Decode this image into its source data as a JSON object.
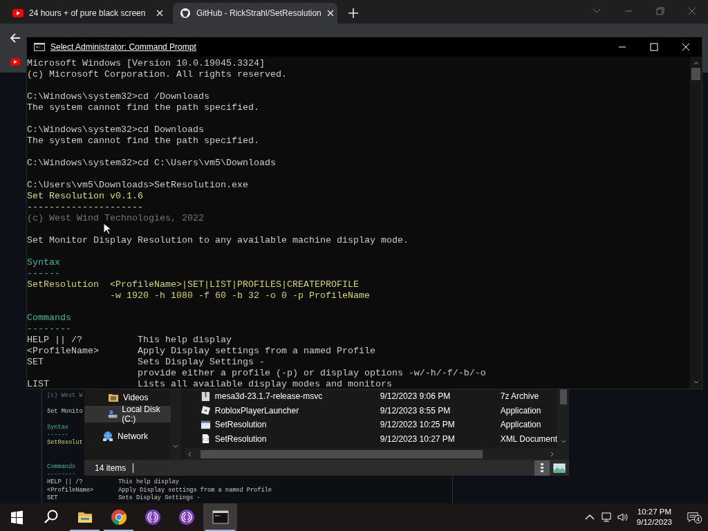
{
  "browser": {
    "tabs": [
      {
        "title": "24 hours + of pure black screen",
        "kind": "video",
        "selected": false
      },
      {
        "title": "GitHub - RickStrahl/SetResolution",
        "kind": "cat",
        "selected": true
      }
    ]
  },
  "console": {
    "title": "Select Administrator: Command Prompt",
    "lines": [
      {
        "text": "Microsoft Windows [Version 10.0.19045.3324]",
        "kind": "normal"
      },
      {
        "text": "(c) Microsoft Corporation. All rights reserved.",
        "kind": "normal"
      },
      {
        "kind": "blank"
      },
      {
        "text": "C:\\Windows\\system32>cd /Downloads",
        "kind": "normal"
      },
      {
        "text": "The system cannot find the path specified.",
        "kind": "normal"
      },
      {
        "kind": "blank"
      },
      {
        "text": "C:\\Windows\\system32>cd Downloads",
        "kind": "normal"
      },
      {
        "text": "The system cannot find the path specified.",
        "kind": "normal"
      },
      {
        "kind": "blank"
      },
      {
        "text": "C:\\Windows\\system32>cd C:\\Users\\vm5\\Downloads",
        "kind": "normal"
      },
      {
        "kind": "blank"
      },
      {
        "text": "C:\\Users\\vm5\\Downloads>SetResolution.exe",
        "kind": "normal"
      },
      {
        "text": "Set Resolution v0.1.6",
        "kind": "accent"
      },
      {
        "text": "---------------------",
        "kind": "accent"
      },
      {
        "text": "(c) West Wind Technologies, 2022",
        "kind": "dim"
      },
      {
        "kind": "blank"
      },
      {
        "text": "Set Monitor Display Resolution to any available machine display mode.",
        "kind": "normal"
      },
      {
        "kind": "blank"
      },
      {
        "text": "Syntax",
        "kind": "heading"
      },
      {
        "text": "------",
        "kind": "heading"
      },
      {
        "text": "SetResolution  <ProfileName>|SET|LIST|PROFILES|CREATEPROFILE",
        "kind": "syntax"
      },
      {
        "text": "               -w 1920 -h 1080 -f 60 -b 32 -o 0 -p ProfileName",
        "kind": "syntax"
      },
      {
        "kind": "blank"
      },
      {
        "text": "Commands",
        "kind": "heading"
      },
      {
        "text": "--------",
        "kind": "heading"
      },
      {
        "text": "HELP || /?          This help display",
        "kind": "normal"
      },
      {
        "text": "<ProfileName>       Apply Display settings from a named Profile",
        "kind": "normal"
      },
      {
        "text": "SET                 Sets Display Settings -",
        "kind": "normal"
      },
      {
        "text": "                    provide either a profile (-p) or display options -w/-h/-f/-b/-o",
        "kind": "normal"
      },
      {
        "text": "LIST                Lists all available display modes and monitors",
        "kind": "normal"
      }
    ]
  },
  "background_console": {
    "lines": [
      {
        "text": "(c) West W",
        "kind": "dim"
      },
      {
        "kind": "blank"
      },
      {
        "text": "Set Monito",
        "kind": "normal"
      },
      {
        "kind": "blank"
      },
      {
        "text": "Syntax",
        "kind": "heading"
      },
      {
        "text": "------",
        "kind": "heading"
      },
      {
        "text": "SetResolut",
        "kind": "syntax"
      },
      {
        "kind": "blank"
      },
      {
        "kind": "blank"
      },
      {
        "text": "Commands",
        "kind": "heading"
      },
      {
        "text": "--------",
        "kind": "heading"
      },
      {
        "text": "HELP || /?          This help display",
        "kind": "normal"
      },
      {
        "text": "<ProfileName>       Apply Display settings from a named Profile",
        "kind": "normal"
      },
      {
        "text": "SET                 Sets Display Settings -",
        "kind": "normal"
      }
    ]
  },
  "explorer": {
    "nav": [
      {
        "label": "Videos",
        "kind": "videos",
        "selected": false
      },
      {
        "label": "Local Disk (C:)",
        "kind": "disk",
        "selected": true
      },
      {
        "label": "Network",
        "kind": "network",
        "selected": false
      }
    ],
    "files": [
      {
        "name": "mesa3d-23.1.7-release-msvc",
        "date": "9/12/2023 9:06 PM",
        "type": "7z Archive",
        "kind": "archive"
      },
      {
        "name": "RobloxPlayerLauncher",
        "date": "9/12/2023 8:55 PM",
        "type": "Application",
        "kind": "square"
      },
      {
        "name": "SetResolution",
        "date": "9/12/2023 10:25 PM",
        "type": "Application",
        "kind": "app"
      },
      {
        "name": "SetResolution",
        "date": "9/12/2023 10:27 PM",
        "type": "XML Document",
        "kind": "xml"
      }
    ],
    "status": "14 items"
  },
  "taskbar": {
    "apps": [
      {
        "kind": "folder",
        "open": true,
        "selected": false
      },
      {
        "kind": "browser",
        "open": true,
        "selected": false
      },
      {
        "kind": "onion",
        "open": false,
        "selected": false
      },
      {
        "kind": "onion",
        "open": false,
        "selected": false
      },
      {
        "kind": "terminal",
        "open": true,
        "selected": true
      }
    ],
    "time": "10:27 PM",
    "date": "9/12/2023",
    "notifications": "4"
  }
}
